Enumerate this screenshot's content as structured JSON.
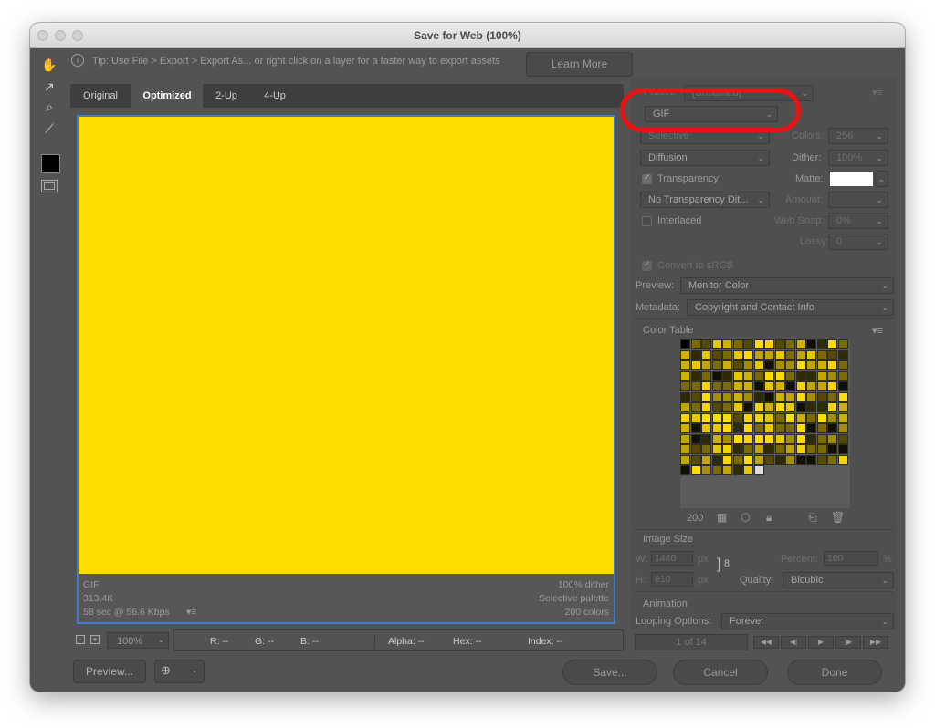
{
  "window": {
    "title": "Save for Web (100%)"
  },
  "tip": {
    "text": "Tip: Use File > Export > Export As... or right click on a layer for a faster way to export assets",
    "learn_more": "Learn More"
  },
  "tabs": [
    {
      "label": "Original"
    },
    {
      "label": "Optimized"
    },
    {
      "label": "2-Up"
    },
    {
      "label": "4-Up"
    }
  ],
  "canvas_info": {
    "format": "GIF",
    "size": "313,4K",
    "speed": "58 sec @ 56.6 Kbps",
    "dither": "100% dither",
    "palette": "Selective palette",
    "colors": "200 colors",
    "fill_color": "#fddc00"
  },
  "status": {
    "zoom": "100%",
    "r": "R: --",
    "g": "G: --",
    "b": "B: --",
    "alpha": "Alpha: --",
    "hex": "Hex: --",
    "index": "Index: --"
  },
  "buttons": {
    "preview": "Preview...",
    "save": "Save...",
    "cancel": "Cancel",
    "done": "Done"
  },
  "settings": {
    "preset_label": "Preset:",
    "preset_value": "[Unnamed]",
    "format": "GIF",
    "reduction": "Selective",
    "colors_label": "Colors:",
    "colors_value": "256",
    "dither_algo": "Diffusion",
    "dither_label": "Dither:",
    "dither_value": "100%",
    "transparency_label": "Transparency",
    "matte_label": "Matte:",
    "transparency_dither": "No Transparency Dit...",
    "amount_label": "Amount:",
    "interlaced_label": "Interlaced",
    "websnap_label": "Web Snap:",
    "websnap_value": "0%",
    "lossy_label": "Lossy:",
    "lossy_value": "0",
    "convert_label": "Convert to sRGB",
    "preview_label": "Preview:",
    "preview_value": "Monitor Color",
    "metadata_label": "Metadata:",
    "metadata_value": "Copyright and Contact Info"
  },
  "color_table": {
    "title": "Color Table",
    "count": "200"
  },
  "image_size": {
    "title": "Image Size",
    "w_label": "W:",
    "w_value": "1440",
    "h_label": "H:",
    "h_value": "810",
    "unit": "px",
    "percent_label": "Percent:",
    "percent_value": "100",
    "percent_unit": "%",
    "quality_label": "Quality:",
    "quality_value": "Bicubic"
  },
  "animation": {
    "title": "Animation",
    "looping_label": "Looping Options:",
    "looping_value": "Forever",
    "frame": "1 of 14"
  },
  "accent_colors": {
    "highlight_ring": "#ee1111",
    "selection_border": "#3d7ed6",
    "yellow": "#fddc00"
  }
}
